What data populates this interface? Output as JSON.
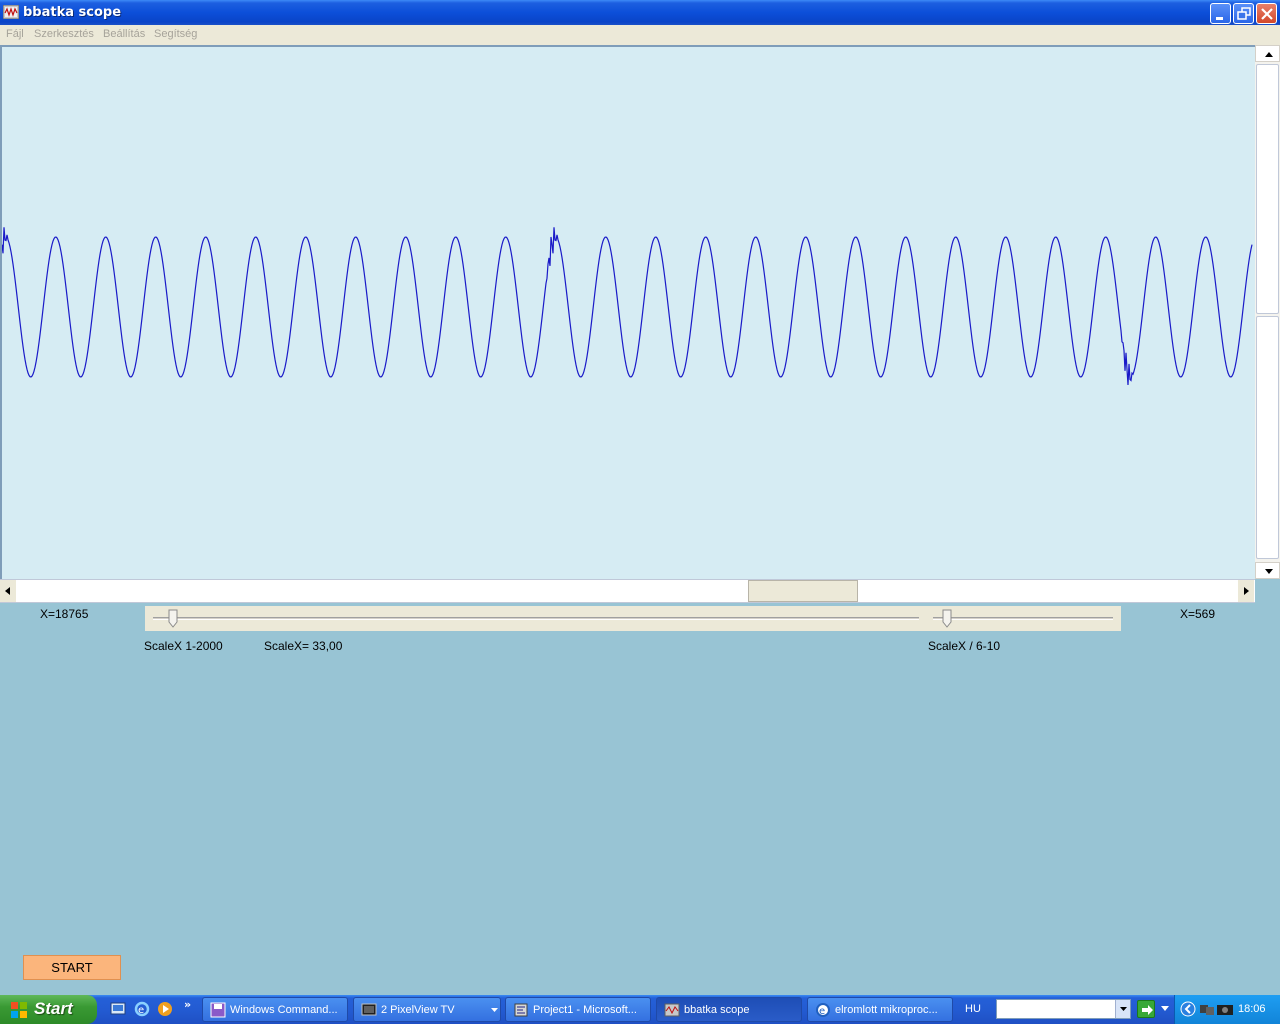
{
  "window": {
    "title": "bbatka scope",
    "controls": [
      "minimize",
      "restore",
      "close"
    ]
  },
  "menu": {
    "items": [
      "Fájl",
      "Szerkesztés",
      "Beállítás",
      "Segítség"
    ]
  },
  "scope": {
    "background": "#d6ecf3",
    "trace_color": "#1a1ac8",
    "chart_data": {
      "type": "line",
      "title": "",
      "xlabel": "",
      "ylabel": "",
      "grid": false,
      "cycles_visible": 25,
      "waveform": "sine",
      "glitches_at_cycles": [
        0,
        11,
        22.5
      ]
    }
  },
  "controls": {
    "x_left": "X=18765",
    "x_right": "X=569",
    "scale_range_label": "ScaleX 1-2000",
    "scale_value_label": "ScaleX= 33,00",
    "scale_div_label": "ScaleX / 6-10",
    "slider_scale_level": 0.02,
    "slider_div_level": 0.05,
    "start_button": "START"
  },
  "taskbar": {
    "start_label": "Start",
    "quick_launch": [
      "show-desktop-icon",
      "ie-icon",
      "media-player-icon"
    ],
    "chevron": "»",
    "tasks": [
      {
        "label": "Windows Command...",
        "icon": "floppy-icon",
        "active": false
      },
      {
        "label": "2 PixelView TV",
        "icon": "tv-icon",
        "active": false
      },
      {
        "label": "Project1 - Microsoft...",
        "icon": "vb-icon",
        "active": false
      },
      {
        "label": "bbatka scope",
        "icon": "scope-icon",
        "active": true
      },
      {
        "label": "elromlott mikroproc...",
        "icon": "ie-icon",
        "active": false
      }
    ],
    "language": "HU",
    "clock": "18:06"
  }
}
